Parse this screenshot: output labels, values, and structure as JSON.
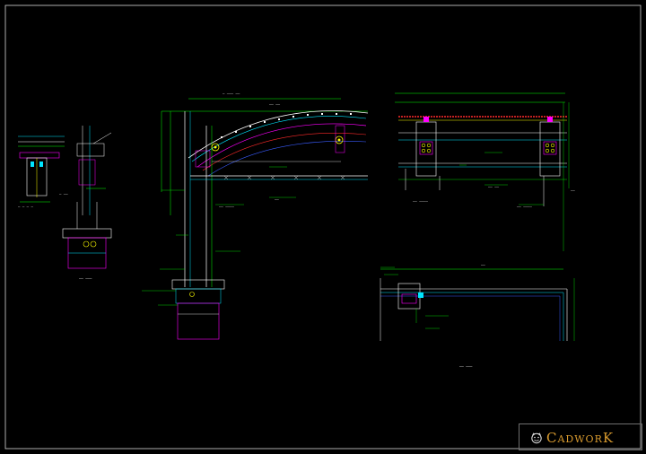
{
  "drawing": {
    "background": "#000000",
    "colors": {
      "frame": "#d8d8d8",
      "primary": "#ffffff",
      "cyan": "#00e5ff",
      "green": "#00ff00",
      "magenta": "#ff00ff",
      "yellow": "#ffff00",
      "red": "#ff2a2a",
      "blue": "#3a5cff",
      "orange": "#ff8c1a"
    }
  },
  "title_block": {
    "brand": "CadworK",
    "logo_icon": "tiger-head-icon",
    "brand_color": "#d89a2e"
  }
}
